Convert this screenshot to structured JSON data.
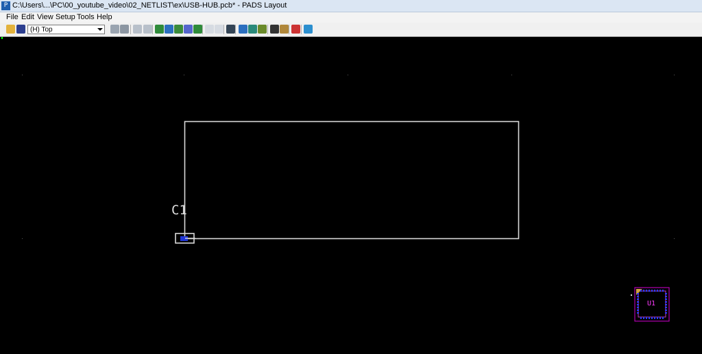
{
  "window": {
    "title": "C:\\Users\\...\\PC\\00_youtube_video\\02_NETLIST\\ex\\USB-HUB.pcb* - PADS Layout",
    "app_icon": "pads-layout-icon"
  },
  "menu": {
    "items": [
      {
        "label": "File"
      },
      {
        "label": "Edit"
      },
      {
        "label": "View"
      },
      {
        "label": "Setup"
      },
      {
        "label": "Tools"
      },
      {
        "label": "Help"
      }
    ]
  },
  "toolbar": {
    "layer_select": {
      "value": "(H) Top"
    },
    "buttons": [
      "open-icon",
      "save-icon",
      "layer-dropdown",
      "properties-icon",
      "zoom-previous-icon",
      "grid-icon",
      "copy-icon",
      "route-icon",
      "component-icon",
      "board-outline-icon",
      "move-icon",
      "push-icon",
      "undo-icon",
      "redo-icon",
      "zoom-icon",
      "design-rules-icon",
      "layer-colors-icon",
      "sketch-route-icon",
      "display-icon",
      "window-icon",
      "verify-design-icon",
      "report-icon"
    ]
  },
  "canvas": {
    "background": "#000000",
    "outline_color": "#d9d9d9",
    "components": [
      {
        "refdes": "C1"
      },
      {
        "refdes": "U1"
      }
    ]
  }
}
